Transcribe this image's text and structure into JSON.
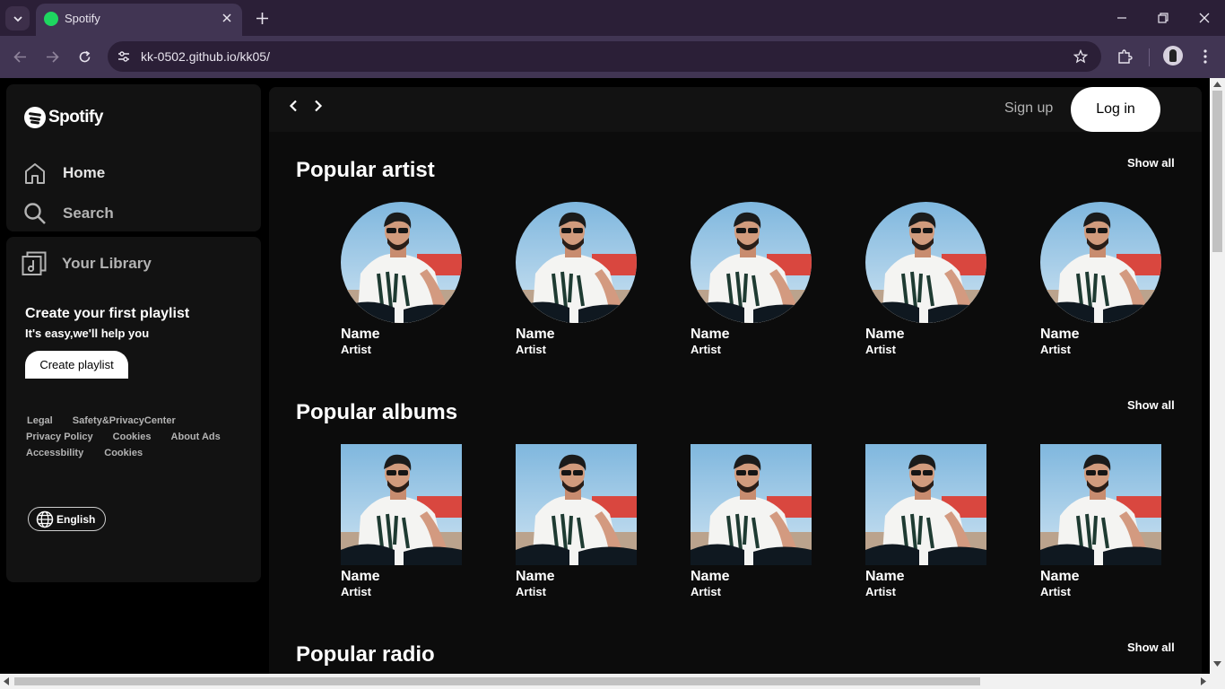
{
  "browser": {
    "tab_title": "Spotify",
    "url": "kk-0502.github.io/kk05/"
  },
  "sidebar": {
    "logo_text": "Spotify",
    "nav": [
      {
        "label": "Home",
        "icon": "home-icon"
      },
      {
        "label": "Search",
        "icon": "search-icon"
      }
    ],
    "library": {
      "label": "Your Library",
      "icon": "library-icon",
      "playlist_title": "Create your first playlist",
      "playlist_subtitle": "It's easy,we'll help you",
      "playlist_button": "Create playlist"
    },
    "footer_links": [
      "Legal",
      "Safety&PrivacyCenter",
      "Privacy Policy",
      "Cookies",
      "About Ads",
      "Accessbility",
      "Cookies"
    ],
    "language": "English"
  },
  "header": {
    "signup_label": "Sign up",
    "login_label": "Log in"
  },
  "sections": [
    {
      "title": "Popular artist",
      "show_all": "Show all",
      "cards": [
        {
          "name": "Name",
          "role": "Artist"
        },
        {
          "name": "Name",
          "role": "Artist"
        },
        {
          "name": "Name",
          "role": "Artist"
        },
        {
          "name": "Name",
          "role": "Artist"
        },
        {
          "name": "Name",
          "role": "Artist"
        }
      ]
    },
    {
      "title": "Popular albums",
      "show_all": "Show all",
      "cards": [
        {
          "name": "Name",
          "role": "Artist"
        },
        {
          "name": "Name",
          "role": "Artist"
        },
        {
          "name": "Name",
          "role": "Artist"
        },
        {
          "name": "Name",
          "role": "Artist"
        },
        {
          "name": "Name",
          "role": "Artist"
        }
      ]
    },
    {
      "title": "Popular radio",
      "show_all": "Show all"
    }
  ],
  "colors": {
    "accent": "#1ed760",
    "panel": "#121212",
    "chrome": "#413553"
  }
}
